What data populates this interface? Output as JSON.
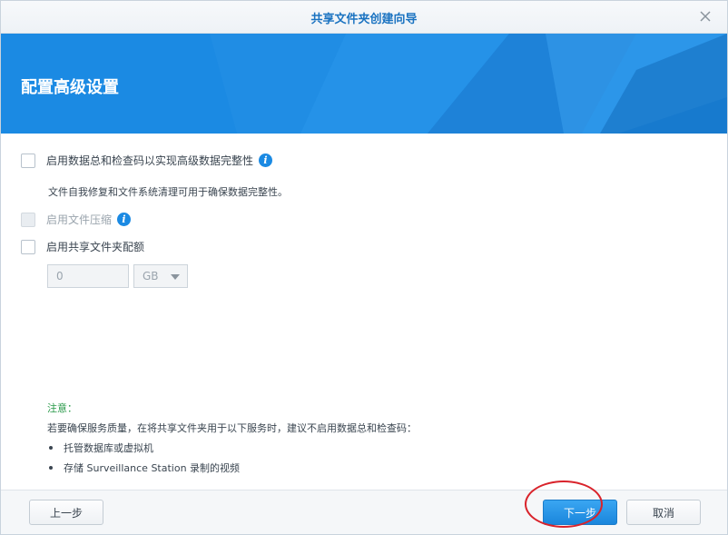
{
  "window": {
    "title": "共享文件夹创建向导",
    "close_icon": "close-icon"
  },
  "banner": {
    "heading": "配置高级设置",
    "color": "#1b8ae3"
  },
  "options": {
    "checksum": {
      "label": "启用数据总和检查码以实现高级数据完整性",
      "description": "文件自我修复和文件系统清理可用于确保数据完整性。",
      "checked": false,
      "icon": "info-icon"
    },
    "compression": {
      "label": "启用文件压缩",
      "enabled": false,
      "checked": false,
      "icon": "info-icon"
    },
    "quota": {
      "label": "启用共享文件夹配额",
      "checked": false,
      "value": "0",
      "unit": "GB"
    }
  },
  "note": {
    "title": "注意：",
    "line": "若要确保服务质量，在将共享文件夹用于以下服务时，建议不启用数据总和检查码：",
    "items": [
      "托管数据库或虚拟机",
      "存储 Surveillance Station 录制的视频"
    ]
  },
  "footer": {
    "back_label": "上一步",
    "next_label": "下一步",
    "cancel_label": "取消"
  },
  "colors": {
    "accent": "#1b8ae3",
    "note_title": "#2a9a4a",
    "annotation": "#d9232b"
  }
}
